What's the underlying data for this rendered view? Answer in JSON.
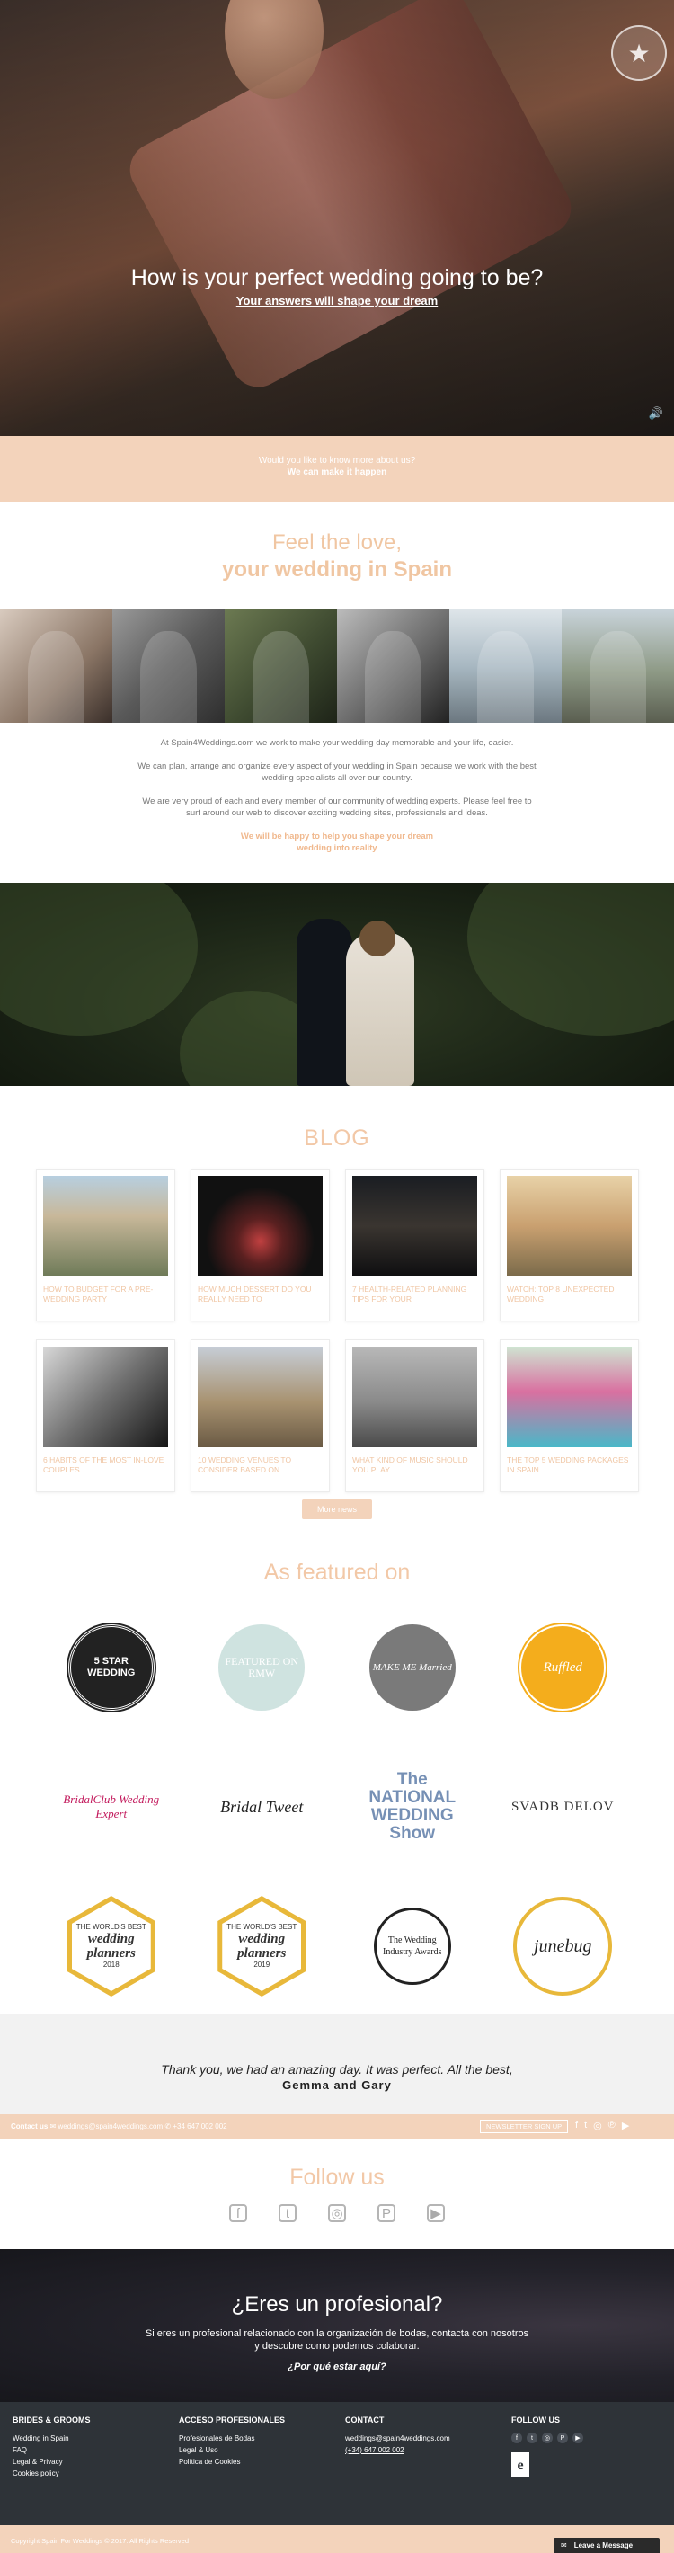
{
  "hero": {
    "title": "How is your perfect wedding going to be?",
    "subtitle": "Your answers will shape your dream",
    "logo_icon": "star-badge-icon",
    "sound_icon": "🔊"
  },
  "peach": {
    "line1": "Would you like to know more about us?",
    "line2": "We can make it happen"
  },
  "feel": {
    "line1": "Feel the love,",
    "line2": "your wedding in Spain"
  },
  "intro": {
    "p1": "At Spain4Weddings.com we work to make your wedding day memorable and your life, easier.",
    "p2": "We can plan, arrange and organize every aspect of your wedding in Spain because we work with the best wedding specialists all over our country.",
    "p3": "We are very proud of each and every member of our community of wedding experts. Please feel free to surf around our web to discover exciting wedding sites, professionals and ideas.",
    "p4a": "We will be happy to help you shape your dream",
    "p4b": "wedding into reality"
  },
  "blog": {
    "title": "BLOG",
    "posts": [
      {
        "caption": "HOW TO BUDGET FOR A PRE-WEDDING PARTY"
      },
      {
        "caption": "HOW MUCH DESSERT DO YOU REALLY NEED TO"
      },
      {
        "caption": "7 HEALTH-RELATED PLANNING TIPS FOR YOUR"
      },
      {
        "caption": "WATCH: TOP 8 UNEXPECTED WEDDING"
      },
      {
        "caption": "6 HABITS OF THE MOST IN-LOVE COUPLES"
      },
      {
        "caption": "10 WEDDING VENUES TO CONSIDER BASED ON"
      },
      {
        "caption": "WHAT KIND OF MUSIC SHOULD YOU PLAY"
      },
      {
        "caption": "THE TOP 5 WEDDING PACKAGES IN SPAIN"
      }
    ],
    "more_label": "More news"
  },
  "featured": {
    "title": "As featured on",
    "row1": [
      "5 STAR WEDDING",
      "FEATURED ON RMW",
      "MAKE ME Married",
      "Ruffled"
    ],
    "row2": [
      "BridalClub Wedding Expert",
      "Bridal Tweet",
      "The NATIONAL WEDDING Show",
      "SVADB DELOV"
    ],
    "planners": {
      "label1": "THE WORLD'S BEST",
      "name": "wedding planners",
      "y2018": "2018",
      "y2019": "2019"
    },
    "row3c": "The Wedding Industry Awards",
    "row3d": "junebug"
  },
  "testimonial": {
    "quote": "Thank you, we had an amazing day. It was perfect. All the best,",
    "author": "Gemma and Gary"
  },
  "contact_bar": {
    "label": "Contact us",
    "email": "weddings@spain4weddings.com",
    "phone": "+34 647 002 002",
    "newsletter": "NEWSLETTER SIGN UP"
  },
  "follow": {
    "title": "Follow us"
  },
  "pro": {
    "title": "¿Eres un profesional?",
    "desc": "Si eres un profesional relacionado con la organización de bodas, contacta con nosotros y descubre como podemos colaborar.",
    "link": "¿Por qué estar aquí?"
  },
  "footer": {
    "col1": {
      "title": "BRIDES & GROOMS",
      "items": [
        "Wedding in Spain",
        "FAQ",
        "Legal & Privacy",
        "Cookies policy"
      ]
    },
    "col2": {
      "title": "ACCESO PROFESIONALES",
      "items": [
        "Profesionales de Bodas",
        "Legal & Uso",
        "Política de Cookies"
      ]
    },
    "col3": {
      "title": "CONTACT",
      "email": "weddings@spain4weddings.com",
      "phone": "(+34) 647 002 002"
    },
    "col4": {
      "title": "FOLLOW US"
    },
    "copyright": "Copyright Spain For Weddings © 2017. All Rights Reserved",
    "leave_message": "Leave a Message"
  }
}
